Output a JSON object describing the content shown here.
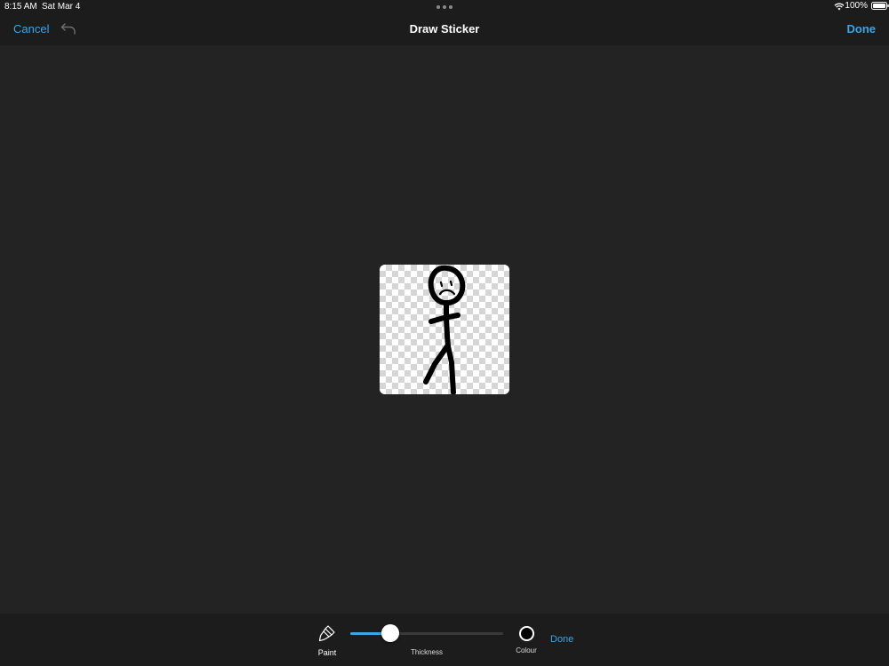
{
  "status_bar": {
    "time": "8:15 AM",
    "date": "Sat Mar 4",
    "battery": "100%"
  },
  "nav": {
    "cancel_label": "Cancel",
    "title": "Draw Sticker",
    "done_label": "Done"
  },
  "toolbar": {
    "paint_label": "Paint",
    "thickness_label": "Thickness",
    "thickness_value": 0.26,
    "colour_label": "Colour",
    "selected_colour": "#000000",
    "done_label": "Done"
  },
  "icons": {
    "undo": "undo-arrow-icon",
    "paint": "paintbrush-icon",
    "wifi": "wifi-icon",
    "battery": "battery-icon"
  },
  "colors": {
    "accent": "#3aa6e8",
    "background": "#232323",
    "bar": "#1c1c1c"
  }
}
